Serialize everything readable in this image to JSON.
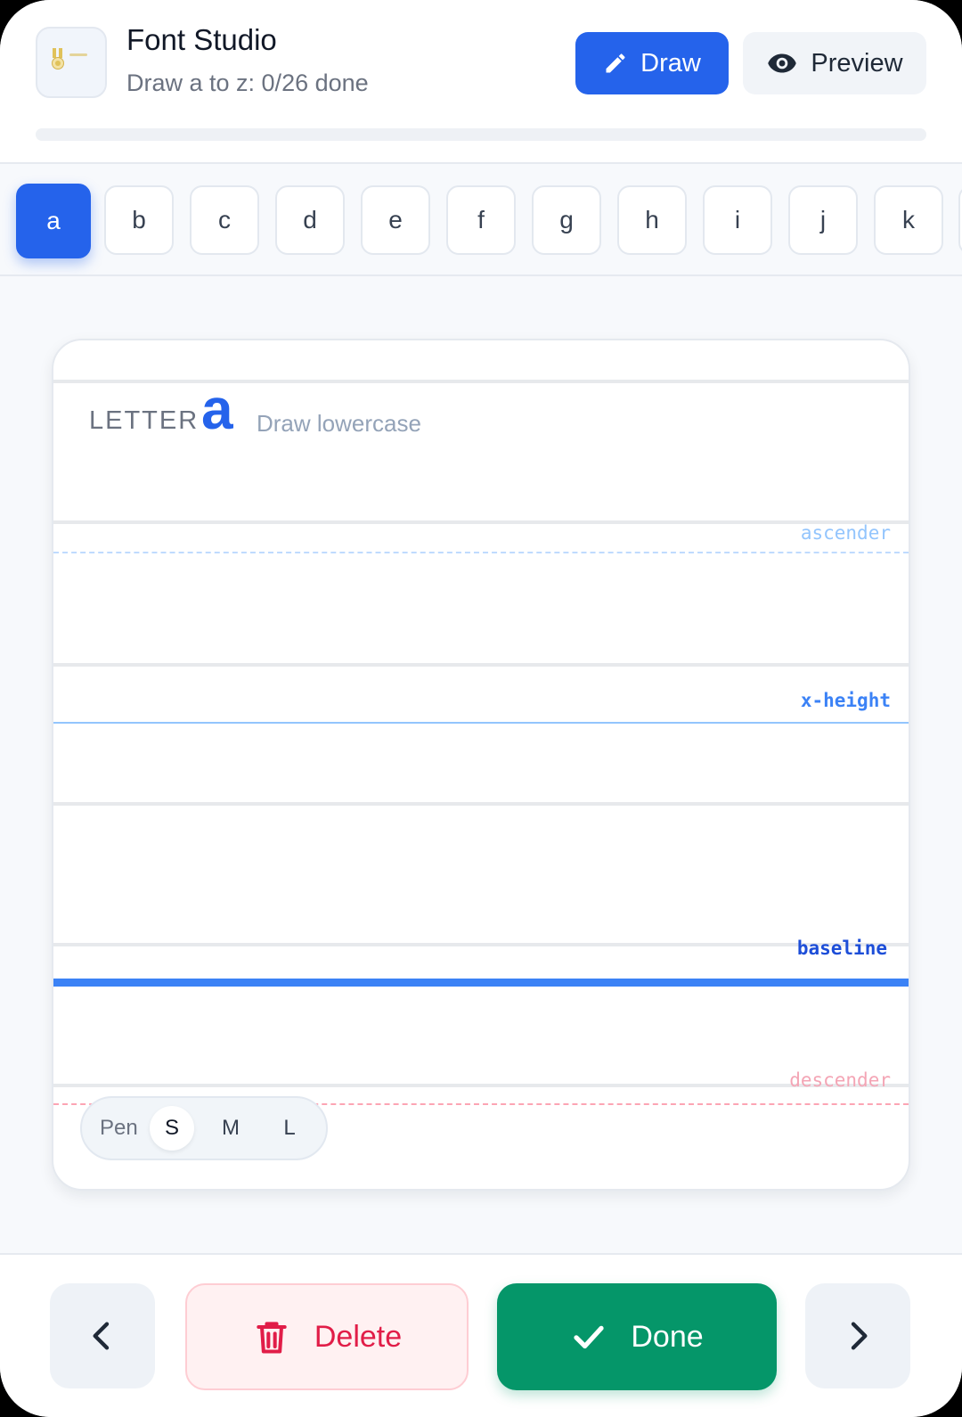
{
  "header": {
    "title": "Font Studio",
    "subtitle": "Draw a to z: 0/26 done",
    "progress_fraction": 0,
    "draw_label": "Draw",
    "preview_label": "Preview"
  },
  "letters": {
    "active": "a",
    "items": [
      "a",
      "b",
      "c",
      "d",
      "e",
      "f",
      "g",
      "h",
      "i",
      "j",
      "k"
    ]
  },
  "canvas": {
    "letter_label": "LETTER",
    "letter": "a",
    "hint": "Draw lowercase",
    "guides": {
      "ascender": "ascender",
      "xheight": "x-height",
      "baseline": "baseline",
      "descender": "descender"
    },
    "pen": {
      "label": "Pen",
      "sizes": [
        "S",
        "M",
        "L"
      ],
      "selected": "S"
    }
  },
  "footer": {
    "delete_label": "Delete",
    "done_label": "Done"
  },
  "colors": {
    "accent": "#2563eb",
    "done": "#059669",
    "delete": "#e11d48"
  },
  "icons": {
    "draw": "pencil-icon",
    "preview": "eye-icon",
    "delete": "trash-icon",
    "done": "check-icon",
    "prev": "chevron-left-icon",
    "next": "chevron-right-icon"
  }
}
